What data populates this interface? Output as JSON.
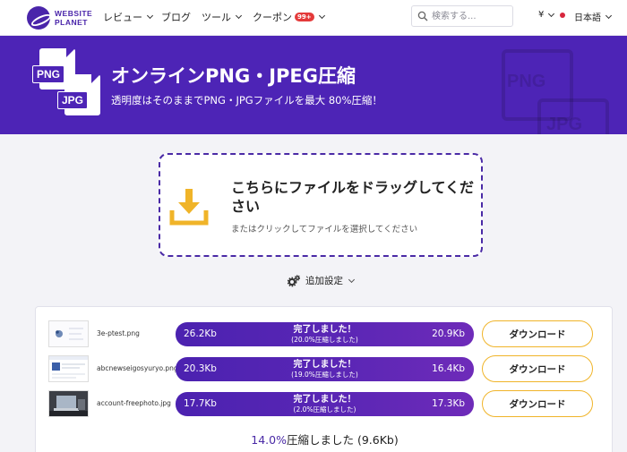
{
  "brand": {
    "line1": "WEBSITE",
    "line2": "PLANET"
  },
  "nav": {
    "items": [
      {
        "label": "レビュー",
        "dropdown": true
      },
      {
        "label": "ブログ",
        "dropdown": false
      },
      {
        "label": "ツール",
        "dropdown": true
      },
      {
        "label": "クーポン",
        "dropdown": true,
        "badge": "99+"
      }
    ],
    "search_placeholder": "検索する...",
    "currency": "¥",
    "language": "日本語"
  },
  "hero": {
    "title": "オンラインPNG・JPEG圧縮",
    "subtitle": "透明度はそのままでPNG・JPGファイルを最大 80%圧縮！",
    "icon_labels": [
      "PNG",
      "JPG"
    ],
    "background_color": "#4d24b6"
  },
  "dropzone": {
    "title": "こちらにファイルをドラッグしてください",
    "subtitle": "またはクリックしてファイルを選択してください",
    "icon": "download-icon",
    "icon_color": "#f0b429"
  },
  "advanced": {
    "label": "追加設定",
    "icon": "gears-icon"
  },
  "results": [
    {
      "filename": "3e-ptest.png",
      "original": "26.2Kb",
      "status": "完了しました！",
      "ratio": "(20.0%圧縮しました)",
      "compressed": "20.9Kb",
      "button": "ダウンロード"
    },
    {
      "filename": "abcnewseigosyuryo.png",
      "original": "20.3Kb",
      "status": "完了しました！",
      "ratio": "(19.0%圧縮しました)",
      "compressed": "16.4Kb",
      "button": "ダウンロード"
    },
    {
      "filename": "account-freephoto.jpg",
      "original": "17.7Kb",
      "status": "完了しました！",
      "ratio": "(2.0%圧縮しました)",
      "compressed": "17.3Kb",
      "button": "ダウンロード"
    }
  ],
  "summary": {
    "percent": "14.0%",
    "text": "圧縮しました (9.6Kb)"
  },
  "colors": {
    "accent": "#4a2aa6",
    "button_border": "#f0b429"
  }
}
